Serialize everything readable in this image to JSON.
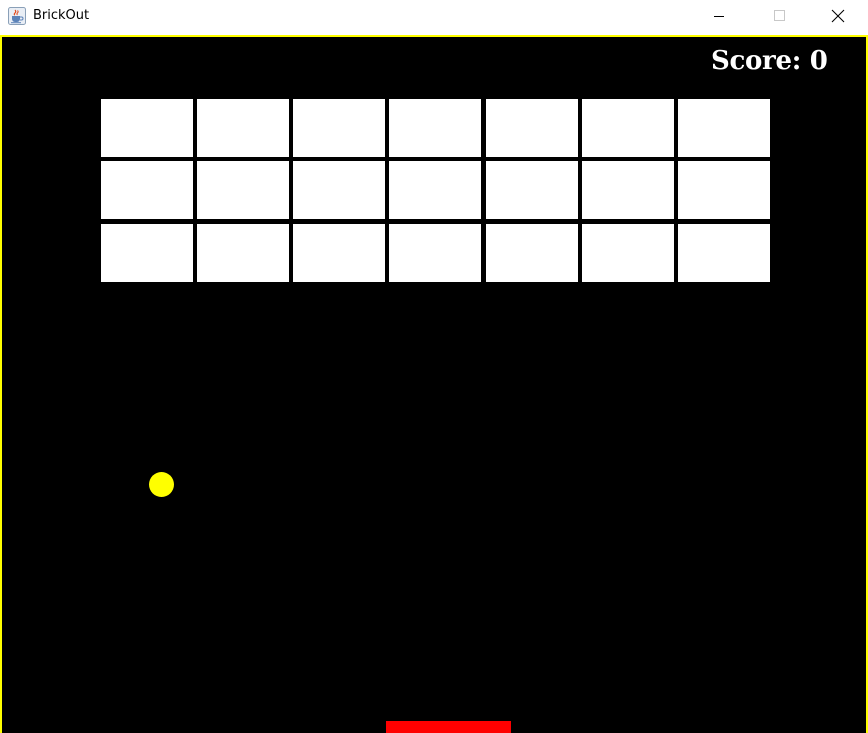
{
  "window": {
    "title": "BrickOut",
    "app_icon": "java-cup-icon",
    "controls": [
      "minimize-icon",
      "maximize-icon",
      "close-icon"
    ]
  },
  "game": {
    "score_label": "Score:",
    "score_value": "0",
    "bricks": {
      "rows": 3,
      "columns": 7,
      "color": "#ffffff"
    },
    "ball_color": "#ffff00",
    "paddle_color": "#ff0000",
    "background_color": "#000000",
    "border_color": "#ffff00"
  }
}
